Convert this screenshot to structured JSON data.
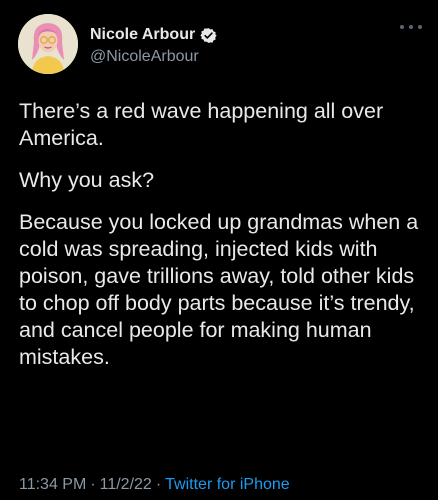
{
  "author": {
    "display_name": "Nicole Arbour",
    "handle": "@NicoleArbour",
    "verified": true
  },
  "tweet": {
    "paragraphs": [
      "There’s a red wave happening all over America.",
      "Why you ask?",
      "Because you locked up grandmas when a cold was spreading, injected kids with poison, gave trillions away, told other kids to chop off body parts because it’s trendy, and cancel people for making human mistakes."
    ],
    "time": "11:34 PM",
    "date": "11/2/22",
    "separator": "·",
    "source": "Twitter for iPhone"
  },
  "icons": {
    "verified": "verified-badge-icon",
    "more": "more-options-icon"
  },
  "colors": {
    "background": "#000000",
    "text": "#e7e9ea",
    "secondary": "#8b98a5",
    "accent": "#1d9bf0"
  }
}
